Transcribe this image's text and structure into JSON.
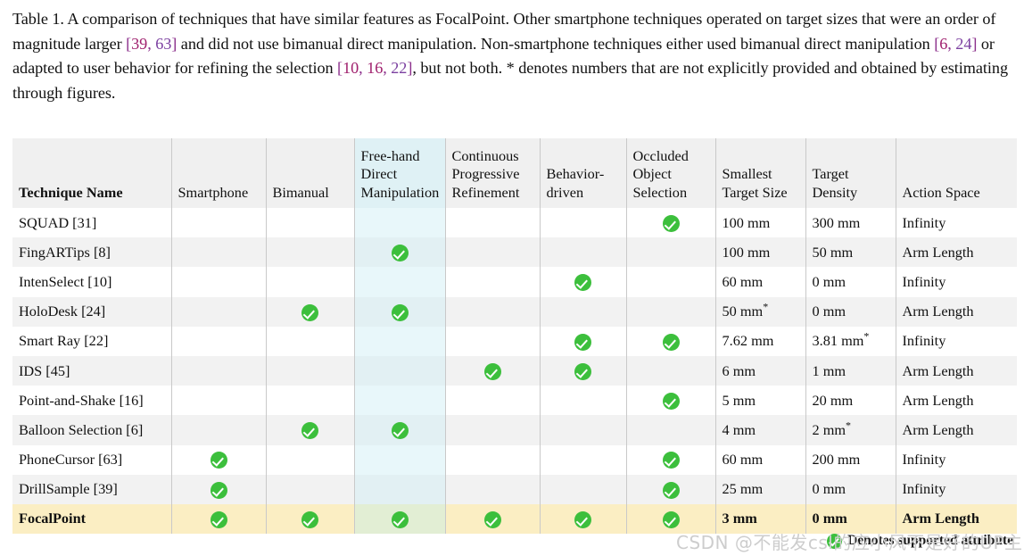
{
  "caption": {
    "label": "Table 1.",
    "text_part_1": "  A comparison of techniques that have similar features as FocalPoint. Other smartphone techniques operated on target sizes that were an order of magnitude larger ",
    "cite_1": "[39, 63]",
    "cite_1_a": "39",
    "cite_1_b": "63",
    "text_part_2": " and did not use bimanual direct manipulation. Non-smartphone techniques either used bimanual direct manipulation ",
    "cite_2": "[6, 24]",
    "cite_2_a": "6",
    "cite_2_b": "24",
    "text_part_3": " or adapted to user behavior for refining the selection ",
    "cite_3": "[10, 16, 22]",
    "cite_3_a": "10",
    "cite_3_b": "16",
    "cite_3_c": "22",
    "text_part_4": ", but not both. * denotes numbers that are not explicitly provided and obtained by estimating through figures."
  },
  "table": {
    "columns": [
      {
        "key": "name",
        "label": "Technique Name"
      },
      {
        "key": "phone",
        "label": "Smartphone"
      },
      {
        "key": "bim",
        "label": "Bimanual"
      },
      {
        "key": "free",
        "label": "Free-hand Direct Manipulation"
      },
      {
        "key": "cont",
        "label": "Continuous Progressive Refinement"
      },
      {
        "key": "beh",
        "label": "Behavior-driven"
      },
      {
        "key": "occ",
        "label": "Occluded Object Selection"
      },
      {
        "key": "size",
        "label": "Smallest Target Size"
      },
      {
        "key": "dens",
        "label": "Target Density"
      },
      {
        "key": "act",
        "label": "Action Space"
      }
    ],
    "header_lines": {
      "name": [
        "Technique Name"
      ],
      "phone": [
        "Smartphone"
      ],
      "bim": [
        "Bimanual"
      ],
      "free": [
        "Free-hand",
        "Direct",
        "Manipulation"
      ],
      "cont": [
        "Continuous",
        "Progressive",
        "Refinement"
      ],
      "beh": [
        "Behavior-",
        "driven"
      ],
      "occ": [
        "Occluded",
        "Object",
        "Selection"
      ],
      "size": [
        "Smallest",
        "Target Size"
      ],
      "dens": [
        "Target",
        "Density"
      ],
      "act": [
        "Action Space"
      ]
    },
    "rows": [
      {
        "name": "SQUAD [31]",
        "phone": false,
        "bim": false,
        "free": false,
        "cont": false,
        "beh": false,
        "occ": true,
        "size": "100 mm",
        "size_star": false,
        "dens": "300 mm",
        "dens_star": false,
        "act": "Infinity",
        "highlight": false
      },
      {
        "name": "FingARTips [8]",
        "phone": false,
        "bim": false,
        "free": true,
        "cont": false,
        "beh": false,
        "occ": false,
        "size": "100 mm",
        "size_star": false,
        "dens": "50 mm",
        "dens_star": false,
        "act": "Arm Length",
        "highlight": false
      },
      {
        "name": "IntenSelect [10]",
        "phone": false,
        "bim": false,
        "free": false,
        "cont": false,
        "beh": true,
        "occ": false,
        "size": "60 mm",
        "size_star": false,
        "dens": "0 mm",
        "dens_star": false,
        "act": "Infinity",
        "highlight": false
      },
      {
        "name": "HoloDesk [24]",
        "phone": false,
        "bim": true,
        "free": true,
        "cont": false,
        "beh": false,
        "occ": false,
        "size": "50 mm",
        "size_star": true,
        "dens": "0 mm",
        "dens_star": false,
        "act": "Arm Length",
        "highlight": false
      },
      {
        "name": "Smart Ray [22]",
        "phone": false,
        "bim": false,
        "free": false,
        "cont": false,
        "beh": true,
        "occ": true,
        "size": "7.62 mm",
        "size_star": false,
        "dens": "3.81 mm",
        "dens_star": true,
        "act": "Infinity",
        "highlight": false
      },
      {
        "name": "IDS [45]",
        "phone": false,
        "bim": false,
        "free": false,
        "cont": true,
        "beh": true,
        "occ": false,
        "size": "6 mm",
        "size_star": false,
        "dens": "1 mm",
        "dens_star": false,
        "act": "Arm Length",
        "highlight": false
      },
      {
        "name": "Point-and-Shake [16]",
        "phone": false,
        "bim": false,
        "free": false,
        "cont": false,
        "beh": false,
        "occ": true,
        "size": "5 mm",
        "size_star": false,
        "dens": "20 mm",
        "dens_star": false,
        "act": "Arm Length",
        "highlight": false
      },
      {
        "name": "Balloon Selection [6]",
        "phone": false,
        "bim": true,
        "free": true,
        "cont": false,
        "beh": false,
        "occ": false,
        "size": "4 mm",
        "size_star": false,
        "dens": "2 mm",
        "dens_star": true,
        "act": "Arm Length",
        "highlight": false
      },
      {
        "name": "PhoneCursor [63]",
        "phone": true,
        "bim": false,
        "free": false,
        "cont": false,
        "beh": false,
        "occ": true,
        "size": "60 mm",
        "size_star": false,
        "dens": "200 mm",
        "dens_star": false,
        "act": "Infinity",
        "highlight": false
      },
      {
        "name": "DrillSample [39]",
        "phone": true,
        "bim": false,
        "free": false,
        "cont": false,
        "beh": false,
        "occ": true,
        "size": "25 mm",
        "size_star": false,
        "dens": "0 mm",
        "dens_star": false,
        "act": "Infinity",
        "highlight": false
      },
      {
        "name": "FocalPoint",
        "phone": true,
        "bim": true,
        "free": true,
        "cont": true,
        "beh": true,
        "occ": true,
        "size": "3 mm",
        "size_star": false,
        "dens": "0 mm",
        "dens_star": false,
        "act": "Arm Length",
        "highlight": true
      }
    ]
  },
  "legend": {
    "text": "Denotes supported attribute",
    "icon": "check-circle-icon"
  },
  "watermark": {
    "text": "CSDN @不能发csl的应小风不是好的UP主"
  },
  "colors": {
    "check_green": "#3cbf3c",
    "header_gray": "#f0f0f0",
    "free_column_blue": "#e8f7fa",
    "highlight_yellow": "#fbeec3",
    "highlight_free_green": "#e2eed4",
    "row_stripe": "#f2f2f2",
    "cite_purple": "#8b2f8b",
    "watermark_gray": "#cdcdcd"
  }
}
